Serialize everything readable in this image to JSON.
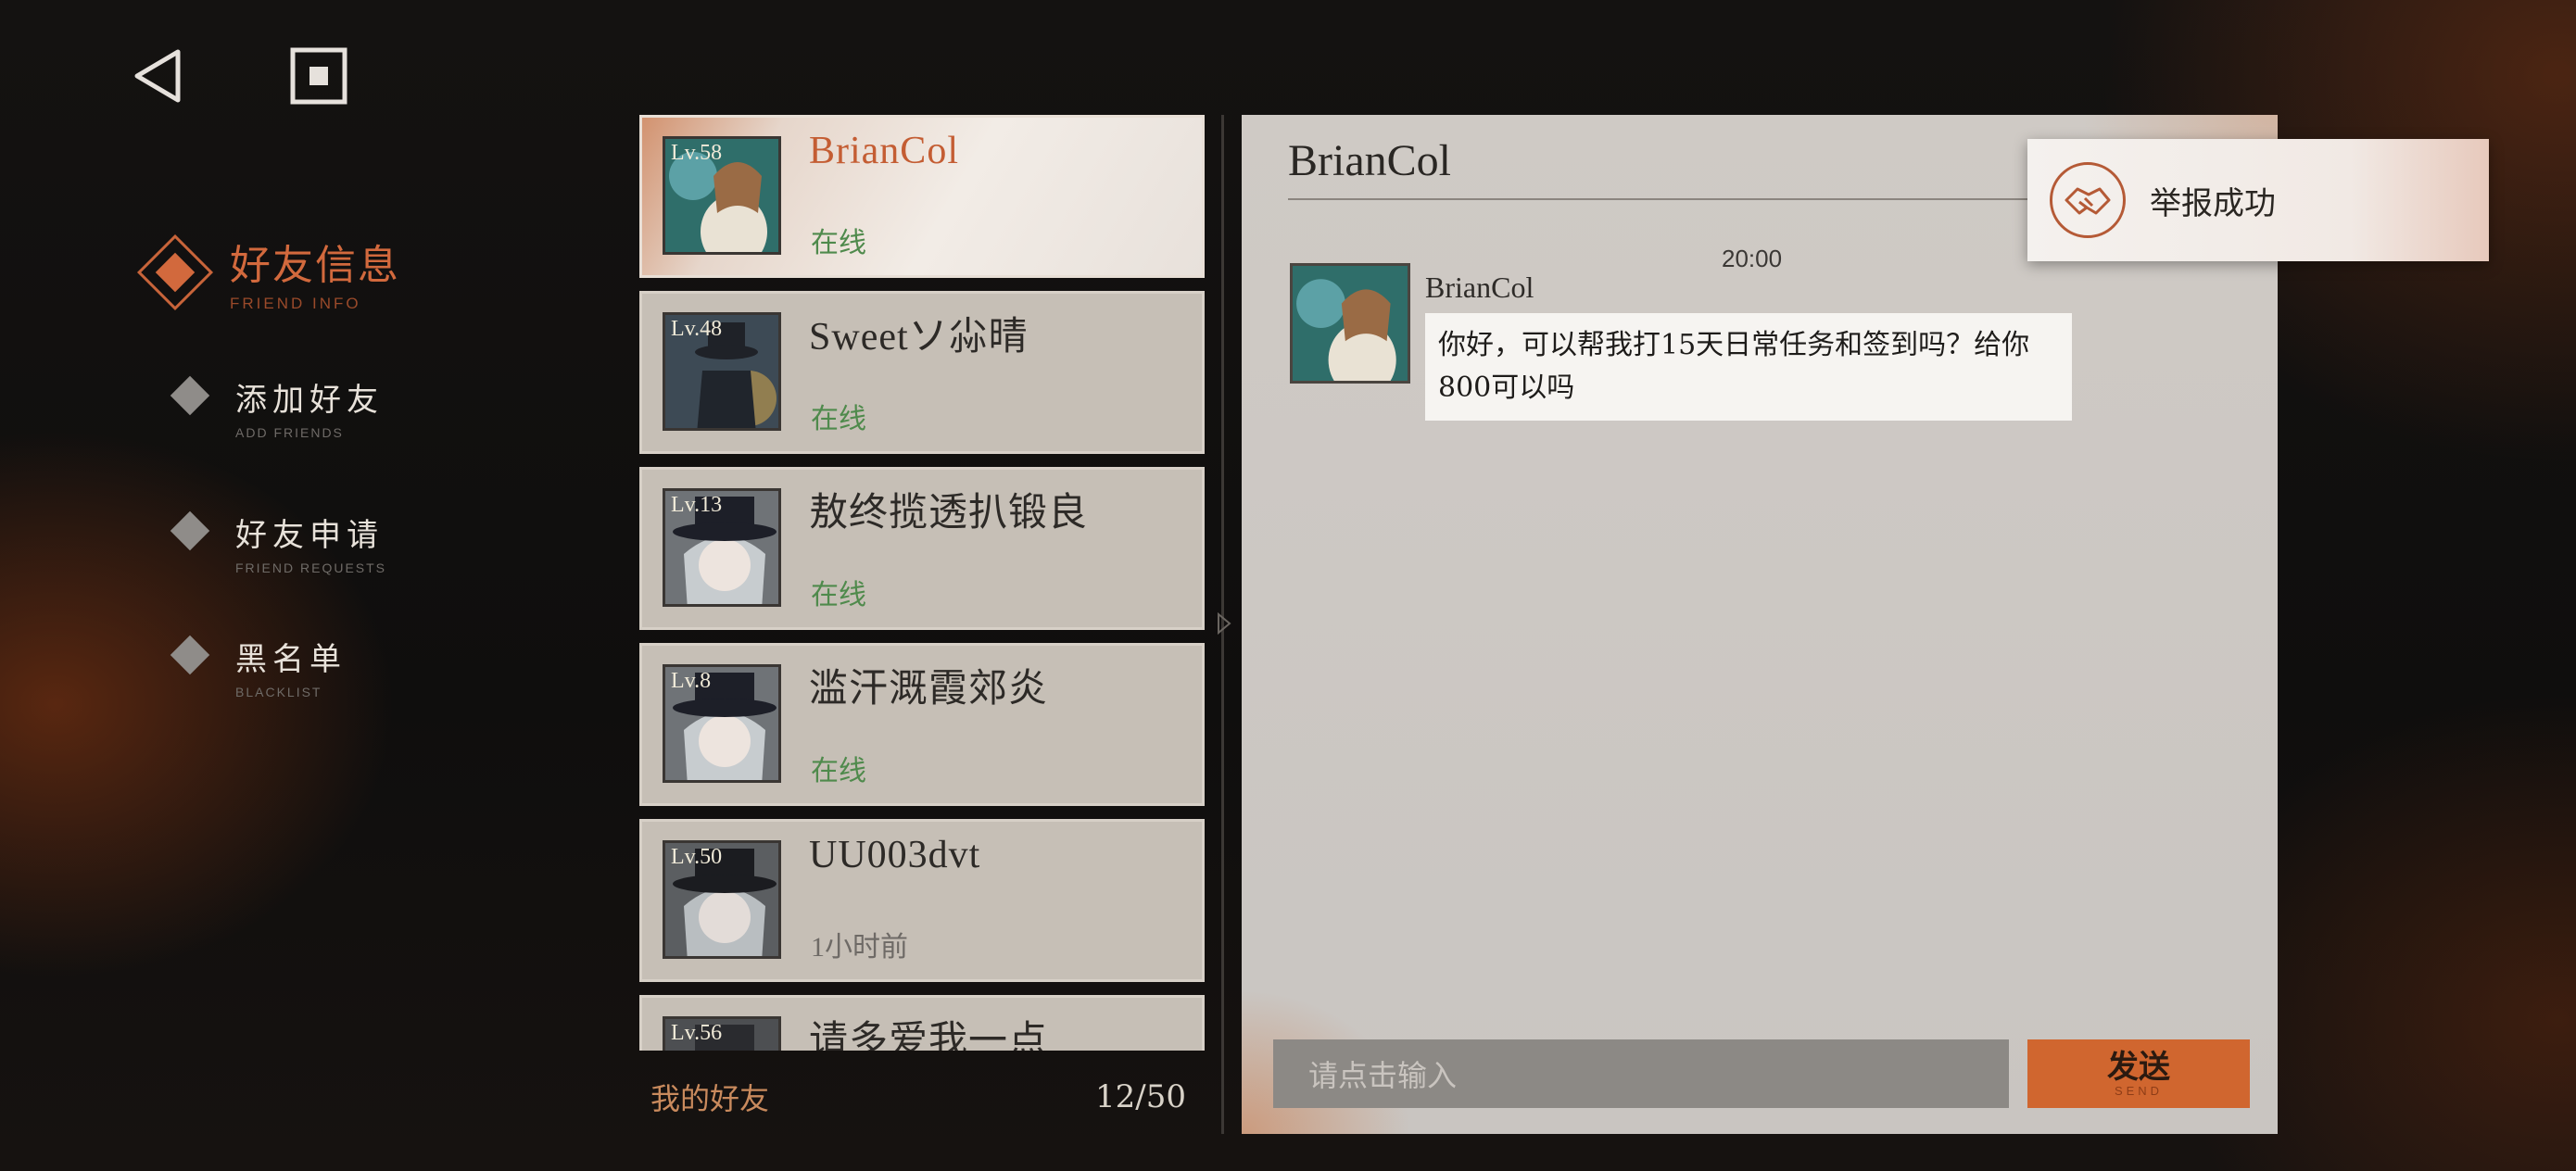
{
  "nav": {
    "back_icon": "back-triangle-icon",
    "home_icon": "square-stop-icon"
  },
  "sidebar": {
    "title_zh": "好友信息",
    "title_en": "FRIEND INFO",
    "items": [
      {
        "zh": "添加好友",
        "en": "ADD FRIENDS"
      },
      {
        "zh": "好友申请",
        "en": "FRIEND REQUESTS"
      },
      {
        "zh": "黑名单",
        "en": "BLACKLIST"
      }
    ]
  },
  "friends": [
    {
      "level": "Lv.58",
      "name": "BrianCol",
      "status": "在线"
    },
    {
      "level": "Lv.48",
      "name": "Sweetソ尛晴",
      "status": "在线"
    },
    {
      "level": "Lv.13",
      "name": "敖终揽透扒锻良",
      "status": "在线"
    },
    {
      "level": "Lv.8",
      "name": "滥汗溉霞郊炎",
      "status": "在线"
    },
    {
      "level": "Lv.50",
      "name": "UU003dvt",
      "status": "1小时前"
    },
    {
      "level": "Lv.56",
      "name": "请多爱我一点",
      "status": ""
    }
  ],
  "list_footer": {
    "label": "我的好友",
    "count": "12/50"
  },
  "chat": {
    "title": "BrianCol",
    "time": "20:00",
    "sender": "BrianCol",
    "message": "你好，可以帮我打15天日常任务和签到吗？给你800可以吗",
    "input_placeholder": "请点击输入",
    "send_zh": "发送",
    "send_en": "SEND"
  },
  "toast": {
    "text": "举报成功",
    "icon": "handshake-icon"
  },
  "colors": {
    "accent": "#d0662f",
    "online": "#4f8a4c"
  }
}
